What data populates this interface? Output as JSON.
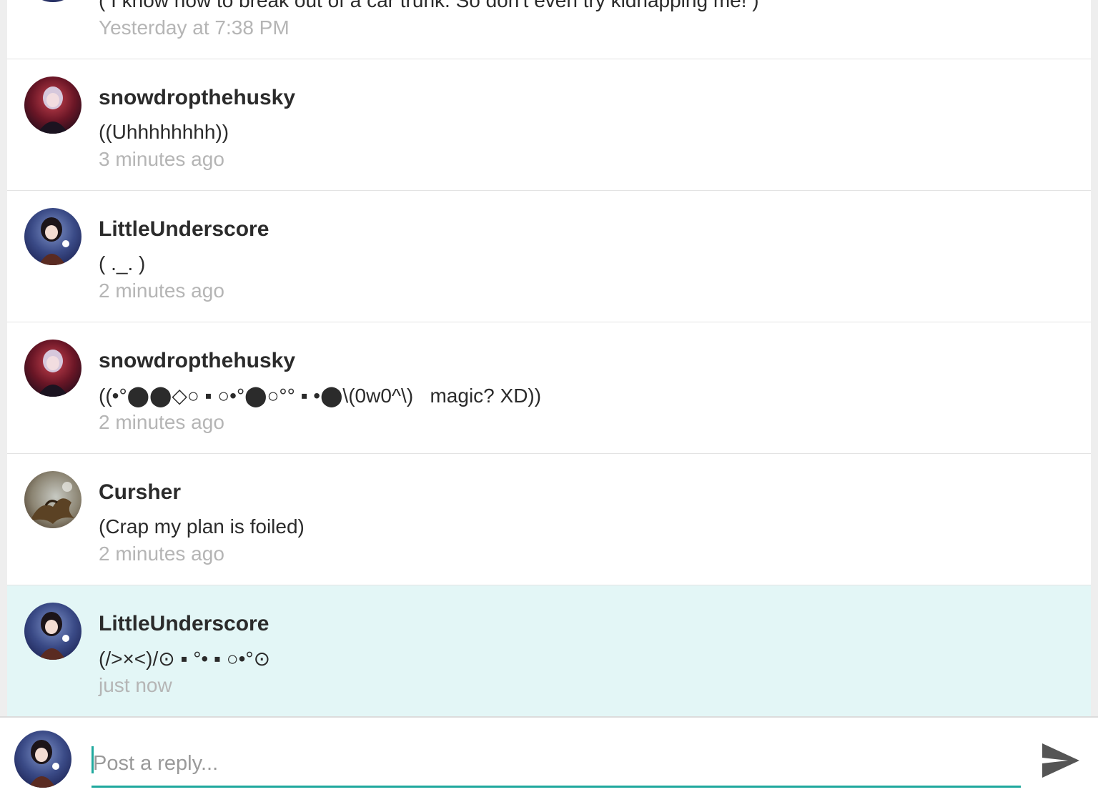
{
  "comments": [
    {
      "author": "",
      "body": "( I know how to break out of a car trunk. So don't even try kidnapping me! )",
      "timestamp": "Yesterday at 7:38 PM",
      "avatar": "partial-avatar"
    },
    {
      "author": "snowdropthehusky",
      "body": "((Uhhhhhhhh))",
      "timestamp": "3 minutes ago",
      "avatar": "anime-girl-red-avatar"
    },
    {
      "author": "LittleUnderscore",
      "body": "( ._. )",
      "timestamp": "2 minutes ago",
      "avatar": "anime-girl-blue-avatar"
    },
    {
      "author": "snowdropthehusky",
      "body": "((•°⬤⬤◇○ ▪ ○•°⬤○°° ▪ •⬤\\(0w0^\\)   magic? XD))",
      "timestamp": "2 minutes ago",
      "avatar": "anime-girl-red-avatar"
    },
    {
      "author": "Cursher",
      "body": "(Crap my plan is foiled)",
      "timestamp": "2 minutes ago",
      "avatar": "dragon-avatar"
    },
    {
      "author": "LittleUnderscore",
      "body": "(/>×<)/⊙ ▪ °• ▪ ○•°⊙",
      "timestamp": "just now",
      "avatar": "anime-girl-blue-avatar"
    }
  ],
  "reply": {
    "placeholder": "Post a reply...",
    "value": "",
    "send_icon": "send-icon"
  },
  "colors": {
    "accent": "#1fa89d",
    "highlight_bg": "#e3f6f6",
    "timestamp": "#b5b5b5",
    "text": "#2b2b2b"
  }
}
